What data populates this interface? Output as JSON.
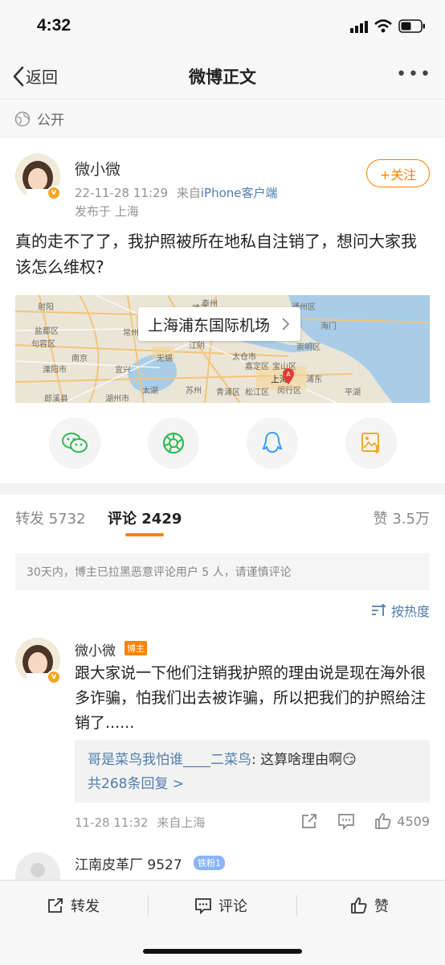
{
  "status_bar": {
    "time": "4:32"
  },
  "nav": {
    "back_label": "返回",
    "title": "微博正文",
    "more": "•••"
  },
  "visibility": {
    "label": "公开"
  },
  "post": {
    "author": "微小微",
    "timestamp": "22-11-28 11:29",
    "source_prefix": "来自",
    "source": "iPhone客户端",
    "location": "发布于 上海",
    "follow_label": "+关注",
    "text": "真的走不了了，我护照被所在地私自注销了，想问大家我该怎么维权?"
  },
  "map": {
    "place": "上海浦东国际机场",
    "labels": [
      "射阳",
      "盐都区",
      "南通",
      "常州",
      "无锡",
      "苏州",
      "上海",
      "湖州市",
      "海门",
      "崇明区",
      "宝山区",
      "嘉定区",
      "太仓市",
      "南京",
      "溧阳市",
      "郎溪县",
      "平湖",
      "句容区",
      "通州区",
      "靖江",
      "泰州",
      "宜兴",
      "太湖",
      "松江区",
      "浦东",
      "闵行区",
      "青浦区",
      "江阴"
    ]
  },
  "share_icons": [
    "wechat-icon",
    "moments-icon",
    "qq-icon",
    "save-image-icon"
  ],
  "share_colors": {
    "wechat": "#2dbb4f",
    "moments": "#2dbb4f",
    "qq": "#3b9cf3",
    "save": "#f5a623"
  },
  "tabs": {
    "repost": "转发 5732",
    "comments": "评论 2429",
    "likes": "赞 3.5万"
  },
  "notice": "30天内，博主已拉黑恶意评论用户 5 人，请谨慎评论",
  "sort_label": "按热度",
  "comment": {
    "author": "微小微",
    "owner_badge": "博主",
    "text": "跟大家说一下他们注销我护照的理由说是现在海外很多诈骗，怕我们出去被诈骗，所以把我们的护照给注销了......",
    "reply_user": "哥是菜鸟我怕谁____二菜鸟",
    "reply_text": ": 这算啥理由啊😏",
    "reply_more": "共268条回复 >",
    "time": "11-28 11:32",
    "location": "来自上海",
    "like_count": "4509"
  },
  "comment2": {
    "author": "江南皮革厂 9527",
    "fan_badge": "铁粉1"
  },
  "bottom_bar": {
    "repost": "转发",
    "comment": "评论",
    "like": "赞"
  },
  "colors": {
    "accent": "#ff8200",
    "link": "#507daf"
  }
}
